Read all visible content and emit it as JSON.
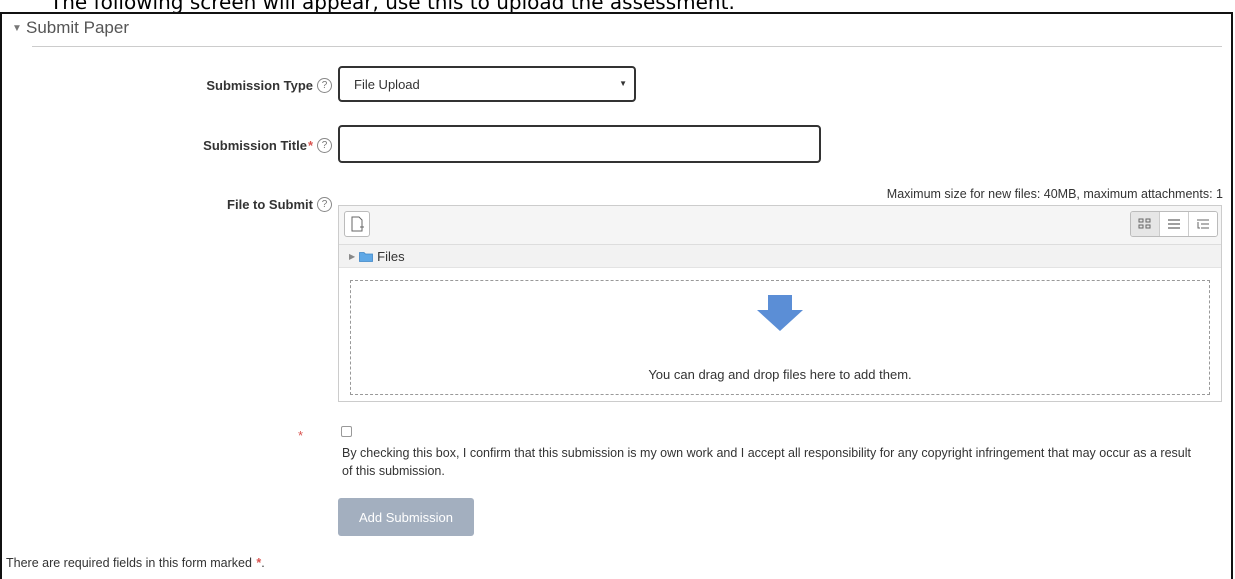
{
  "caption": "The following screen will appear, use this to upload the assessment.",
  "section": {
    "title": "Submit Paper"
  },
  "form": {
    "submission_type": {
      "label": "Submission Type",
      "value": "File Upload"
    },
    "submission_title": {
      "label": "Submission Title",
      "required_mark": "*",
      "value": ""
    },
    "file_to_submit": {
      "label": "File to Submit",
      "max_info": "Maximum size for new files: 40MB, maximum attachments: 1",
      "folder_label": "Files",
      "drop_text": "You can drag and drop files here to add them."
    },
    "agreement": {
      "required_mark": "*",
      "text": "By checking this box, I confirm that this submission is my own work and I accept all responsibility for any copyright infringement that may occur as a result of this submission."
    },
    "submit_label": "Add Submission",
    "footnote": "There are required fields in this form marked",
    "footnote_mark": "*",
    "footnote_end": "."
  },
  "icons": {
    "help": "?",
    "collapse": "▼",
    "dropdown": "▼",
    "path_expand": "▶"
  },
  "colors": {
    "required": "#d9534f",
    "button": "#a3afbf",
    "drop_arrow": "#5b8ed6"
  }
}
